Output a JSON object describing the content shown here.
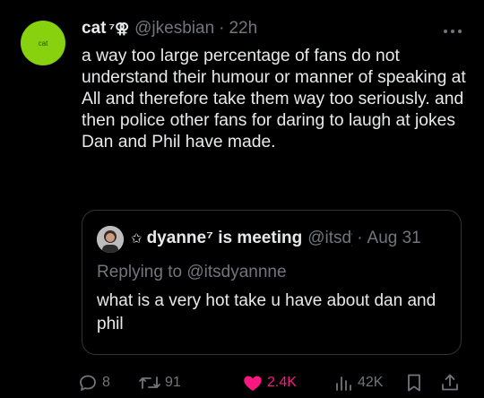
{
  "tweet": {
    "avatar_text": "cat",
    "name": "cat",
    "name_suffix": "⁷⚢",
    "handle": "@jkesbian",
    "separator": "·",
    "time": "22h",
    "text": "a way too large percentage of fans do not understand their humour or manner of speaking at All and therefore take them way too seriously. and then police other fans for daring to laugh at jokes Dan and Phil have made."
  },
  "quote": {
    "star": "✩",
    "name": "dyanne⁷ is meeting",
    "handle": "@itsdyannne",
    "separator": "·",
    "time": "Aug 31",
    "replying_to": "Replying to @itsdyannne",
    "text": "what is a very hot take u have about dan and phil"
  },
  "actions": {
    "replies": "8",
    "retweets": "91",
    "likes": "2.4K",
    "views": "42K",
    "icons": [
      "reply-icon",
      "retweet-icon",
      "heart-icon",
      "views-icon",
      "bookmark-icon",
      "share-icon"
    ]
  },
  "colors": {
    "background": "#000000",
    "text": "#e7e9ea",
    "muted": "#71767b",
    "like": "#f91880",
    "avatar": "#88d10f",
    "border": "#2f3336"
  }
}
